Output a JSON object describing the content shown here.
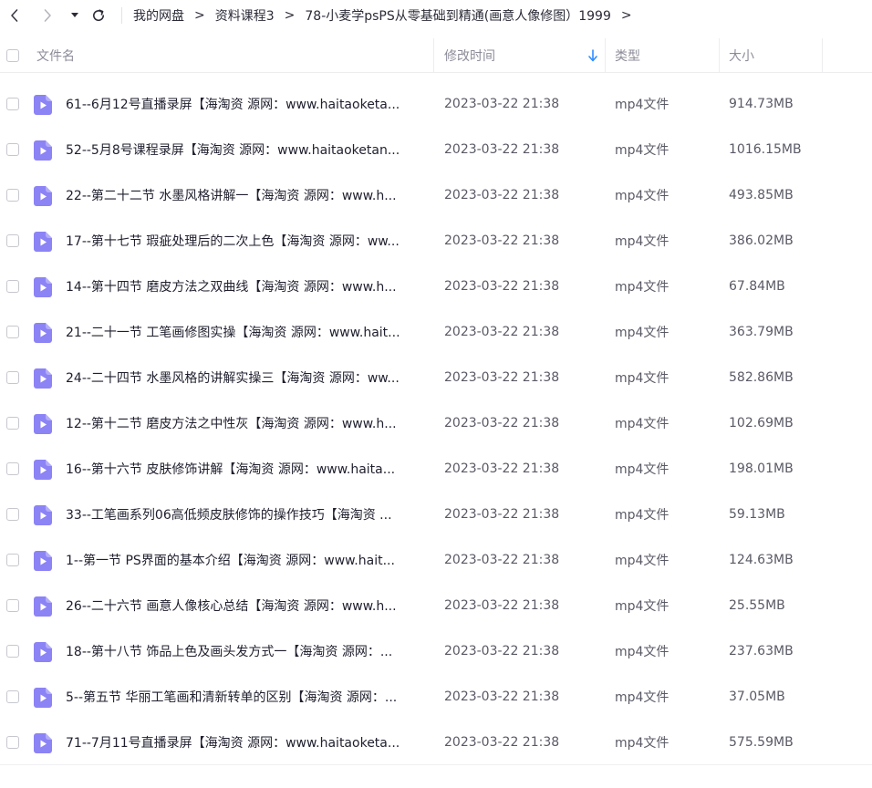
{
  "breadcrumb": {
    "items": [
      "我的网盘",
      "资料课程3",
      "78-小麦学psPS从零基础到精通(画意人像修图）1999"
    ],
    "separator": ">"
  },
  "header": {
    "name": "文件名",
    "modified": "修改时间",
    "type": "类型",
    "size": "大小"
  },
  "colors": {
    "accent": "#2f8cff",
    "file_icon": "#8c83f5"
  },
  "icons": {
    "back": "chevron-left-icon",
    "forward": "chevron-right-icon",
    "history": "dropdown-arrow-icon",
    "refresh": "refresh-icon",
    "sort": "sort-down-arrow-icon",
    "file": "video-file-icon"
  },
  "files": [
    {
      "name": "61--6月12号直播录屏【海淘资 源网：www.haitaoketa...",
      "time": "2023-03-22 21:38",
      "type": "mp4文件",
      "size": "914.73MB"
    },
    {
      "name": "52--5月8号课程录屏【海淘资 源网：www.haitaoketan...",
      "time": "2023-03-22 21:38",
      "type": "mp4文件",
      "size": "1016.15MB"
    },
    {
      "name": "22--第二十二节 水墨风格讲解一【海淘资 源网：www.h...",
      "time": "2023-03-22 21:38",
      "type": "mp4文件",
      "size": "493.85MB"
    },
    {
      "name": "17--第十七节 瑕疵处理后的二次上色【海淘资 源网：ww...",
      "time": "2023-03-22 21:38",
      "type": "mp4文件",
      "size": "386.02MB"
    },
    {
      "name": "14--第十四节 磨皮方法之双曲线【海淘资 源网：www.h...",
      "time": "2023-03-22 21:38",
      "type": "mp4文件",
      "size": "67.84MB"
    },
    {
      "name": "21--二十一节 工笔画修图实操【海淘资 源网：www.hait...",
      "time": "2023-03-22 21:38",
      "type": "mp4文件",
      "size": "363.79MB"
    },
    {
      "name": "24--二十四节 水墨风格的讲解实操三【海淘资 源网：ww...",
      "time": "2023-03-22 21:38",
      "type": "mp4文件",
      "size": "582.86MB"
    },
    {
      "name": "12--第十二节 磨皮方法之中性灰【海淘资 源网：www.h...",
      "time": "2023-03-22 21:38",
      "type": "mp4文件",
      "size": "102.69MB"
    },
    {
      "name": "16--第十六节 皮肤修饰讲解【海淘资 源网：www.haita...",
      "time": "2023-03-22 21:38",
      "type": "mp4文件",
      "size": "198.01MB"
    },
    {
      "name": "33--工笔画系列06高低频皮肤修饰的操作技巧【海淘资 ...",
      "time": "2023-03-22 21:38",
      "type": "mp4文件",
      "size": "59.13MB"
    },
    {
      "name": "1--第一节 PS界面的基本介绍【海淘资 源网：www.hait...",
      "time": "2023-03-22 21:38",
      "type": "mp4文件",
      "size": "124.63MB"
    },
    {
      "name": "26--二十六节 画意人像核心总结【海淘资 源网：www.h...",
      "time": "2023-03-22 21:38",
      "type": "mp4文件",
      "size": "25.55MB"
    },
    {
      "name": "18--第十八节 饰品上色及画头发方式一【海淘资 源网：...",
      "time": "2023-03-22 21:38",
      "type": "mp4文件",
      "size": "237.63MB"
    },
    {
      "name": "5--第五节 华丽工笔画和清新转单的区别【海淘资 源网：...",
      "time": "2023-03-22 21:38",
      "type": "mp4文件",
      "size": "37.05MB"
    },
    {
      "name": "71--7月11号直播录屏【海淘资 源网：www.haitaoketa...",
      "time": "2023-03-22 21:38",
      "type": "mp4文件",
      "size": "575.59MB"
    }
  ]
}
